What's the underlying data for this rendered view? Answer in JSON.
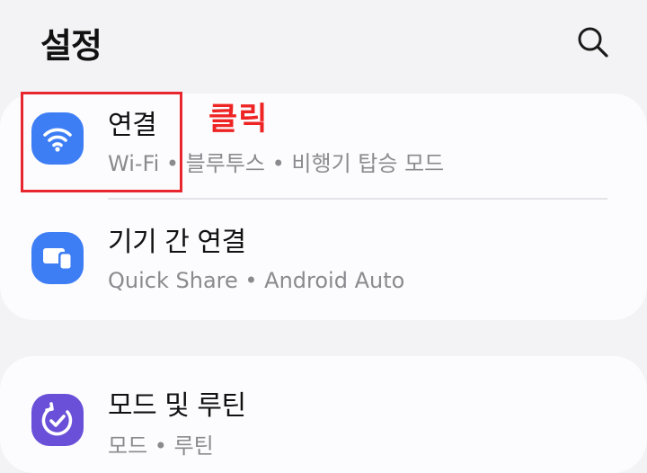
{
  "header": {
    "title": "설정",
    "search_icon": "search-icon"
  },
  "settings": [
    {
      "title": "연결",
      "subtitle": "Wi-Fi  •  블루투스  •  비행기 탑승 모드",
      "icon": "wifi-icon",
      "icon_color": "#3e7ef5"
    },
    {
      "title": "기기 간 연결",
      "subtitle": "Quick Share  •  Android Auto",
      "icon": "device-connection-icon",
      "icon_color": "#3e7ef5"
    },
    {
      "title": "모드 및 루틴",
      "subtitle": "모드  •  루틴",
      "icon": "modes-routines-icon",
      "icon_color": "#6a4fd8"
    }
  ],
  "annotation": {
    "label": "클릭",
    "color": "#ee2424"
  },
  "colors": {
    "background": "#f3f3f5",
    "card": "#fcfcfe",
    "title_text": "#111111",
    "subtitle_text": "#8a8a8f"
  }
}
